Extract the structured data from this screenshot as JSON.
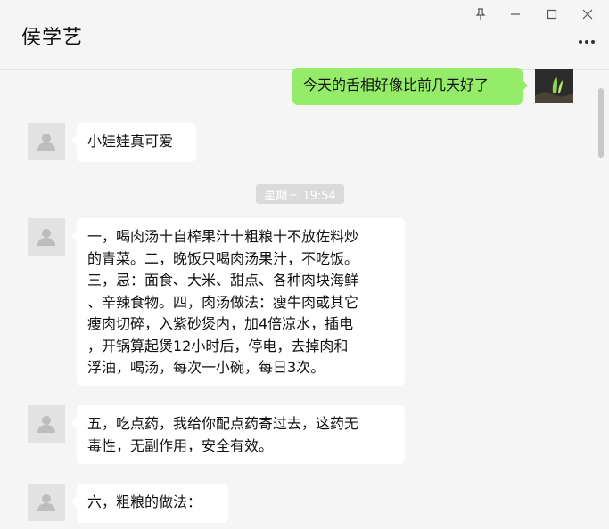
{
  "window": {
    "contact_name": "侯学艺",
    "pin_icon": "pin-icon",
    "minimize_icon": "minimize-icon",
    "maximize_icon": "maximize-icon",
    "close_icon": "close-icon",
    "more_icon": "more-icon"
  },
  "messages": [
    {
      "sender": "self",
      "text": "今天的舌相好像比前几天好了"
    },
    {
      "sender": "contact",
      "text": "小娃娃真可爱"
    },
    {
      "type": "time",
      "text": "星期三 19:54"
    },
    {
      "sender": "contact",
      "text": "一，喝肉汤十自榨果汁十粗粮十不放佐料炒\n的青菜。二，晚饭只喝肉汤果汁，不吃饭。\n三，忌：面食、大米、甜点、各种肉块海鲜\n、辛辣食物。四，肉汤做法：瘦牛肉或其它\n瘦肉切碎，入紫砂煲内，加4倍凉水，插电\n，开锅算起煲12小时后，停电，去掉肉和\n浮油，喝汤，每次一小碗，每日3次。"
    },
    {
      "sender": "contact",
      "text": "五，吃点药，我给你配点药寄过去，这药无\n毒性，无副作用，安全有效。"
    },
    {
      "sender": "contact",
      "text": "六，粗粮的做法："
    }
  ],
  "colors": {
    "self_bubble": "#95ec69",
    "contact_bubble": "#ffffff",
    "background": "#f5f5f5"
  }
}
